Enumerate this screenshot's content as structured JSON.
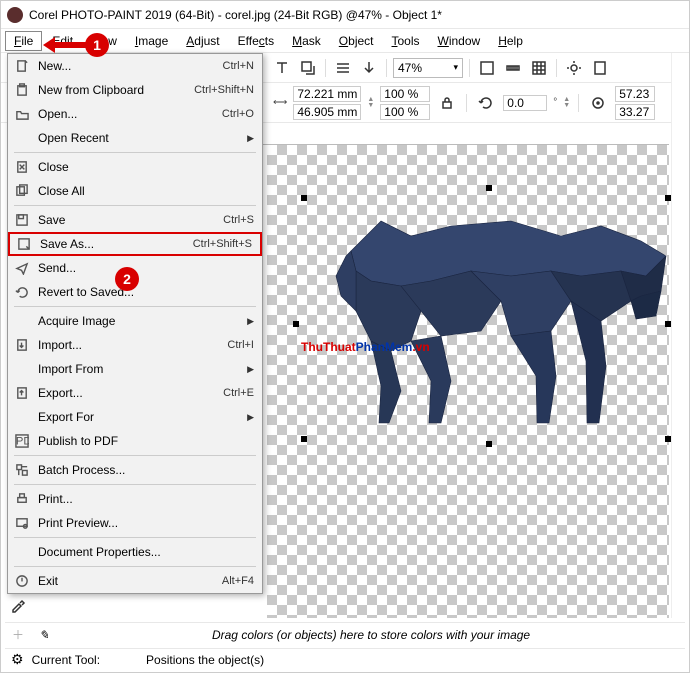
{
  "title": "Corel PHOTO-PAINT 2019 (64-Bit) - corel.jpg (24-Bit RGB) @47% - Object 1*",
  "menubar": [
    "File",
    "Edit",
    "View",
    "Image",
    "Adjust",
    "Effects",
    "Mask",
    "Object",
    "Tools",
    "Window",
    "Help"
  ],
  "menubar_ul": [
    "F",
    "E",
    "V",
    "I",
    "A",
    "c",
    "M",
    "O",
    "T",
    "W",
    "H"
  ],
  "zoom": "47%",
  "props": {
    "w_val": "72.221 mm",
    "h_val": "46.905 mm",
    "sx": "100 %",
    "sy": "100 %",
    "angle": "0.0",
    "deg": "°",
    "cx": "57.23",
    "cy": "33.27"
  },
  "dropdown": {
    "items": [
      {
        "icon": "new",
        "label": "New...",
        "u": "N",
        "sc": "Ctrl+N"
      },
      {
        "icon": "newcb",
        "label": "New from Clipboard",
        "u": "",
        "sc": "Ctrl+Shift+N"
      },
      {
        "icon": "open",
        "label": "Open...",
        "u": "O",
        "sc": "Ctrl+O"
      },
      {
        "icon": "",
        "label": "Open Recent",
        "u": "",
        "sc": "",
        "arrow": true
      },
      {
        "hr": true
      },
      {
        "icon": "close",
        "label": "Close",
        "u": "C"
      },
      {
        "icon": "closeall",
        "label": "Close All",
        "u": ""
      },
      {
        "hr": true
      },
      {
        "icon": "save",
        "label": "Save",
        "u": "S",
        "sc": "Ctrl+S"
      },
      {
        "icon": "saveas",
        "label": "Save As...",
        "u": "A",
        "sc": "Ctrl+Shift+S",
        "hl": true
      },
      {
        "icon": "send",
        "label": "Send...",
        "u": "d"
      },
      {
        "icon": "revert",
        "label": "Revert to Saved...",
        "u": ""
      },
      {
        "hr": true
      },
      {
        "icon": "",
        "label": "Acquire Image",
        "u": "",
        "arrow": true
      },
      {
        "icon": "import",
        "label": "Import...",
        "u": "I",
        "sc": "Ctrl+I"
      },
      {
        "icon": "",
        "label": "Import From",
        "u": "",
        "arrow": true
      },
      {
        "icon": "export",
        "label": "Export...",
        "u": "E",
        "sc": "Ctrl+E"
      },
      {
        "icon": "",
        "label": "Export For",
        "u": "r",
        "arrow": true
      },
      {
        "icon": "pdf",
        "label": "Publish to PDF",
        "u": "H"
      },
      {
        "hr": true
      },
      {
        "icon": "batch",
        "label": "Batch Process...",
        "u": "B"
      },
      {
        "hr": true
      },
      {
        "icon": "print",
        "label": "Print...",
        "u": "P"
      },
      {
        "icon": "preview",
        "label": "Print Preview...",
        "u": "v"
      },
      {
        "hr": true
      },
      {
        "icon": "",
        "label": "Document Properties...",
        "u": ""
      },
      {
        "hr": true
      },
      {
        "icon": "exit",
        "label": "Exit",
        "u": "x",
        "sc": "Alt+F4"
      }
    ]
  },
  "watermark": {
    "a": "ThuThuat",
    "b": "PhanMem",
    "c": ".vn"
  },
  "footer_hint": "Drag colors (or objects) here to store colors with your image",
  "current_tool_label": "Current Tool:",
  "current_tool_text": "Positions the object(s)",
  "callouts": {
    "c1": "1",
    "c2": "2"
  }
}
